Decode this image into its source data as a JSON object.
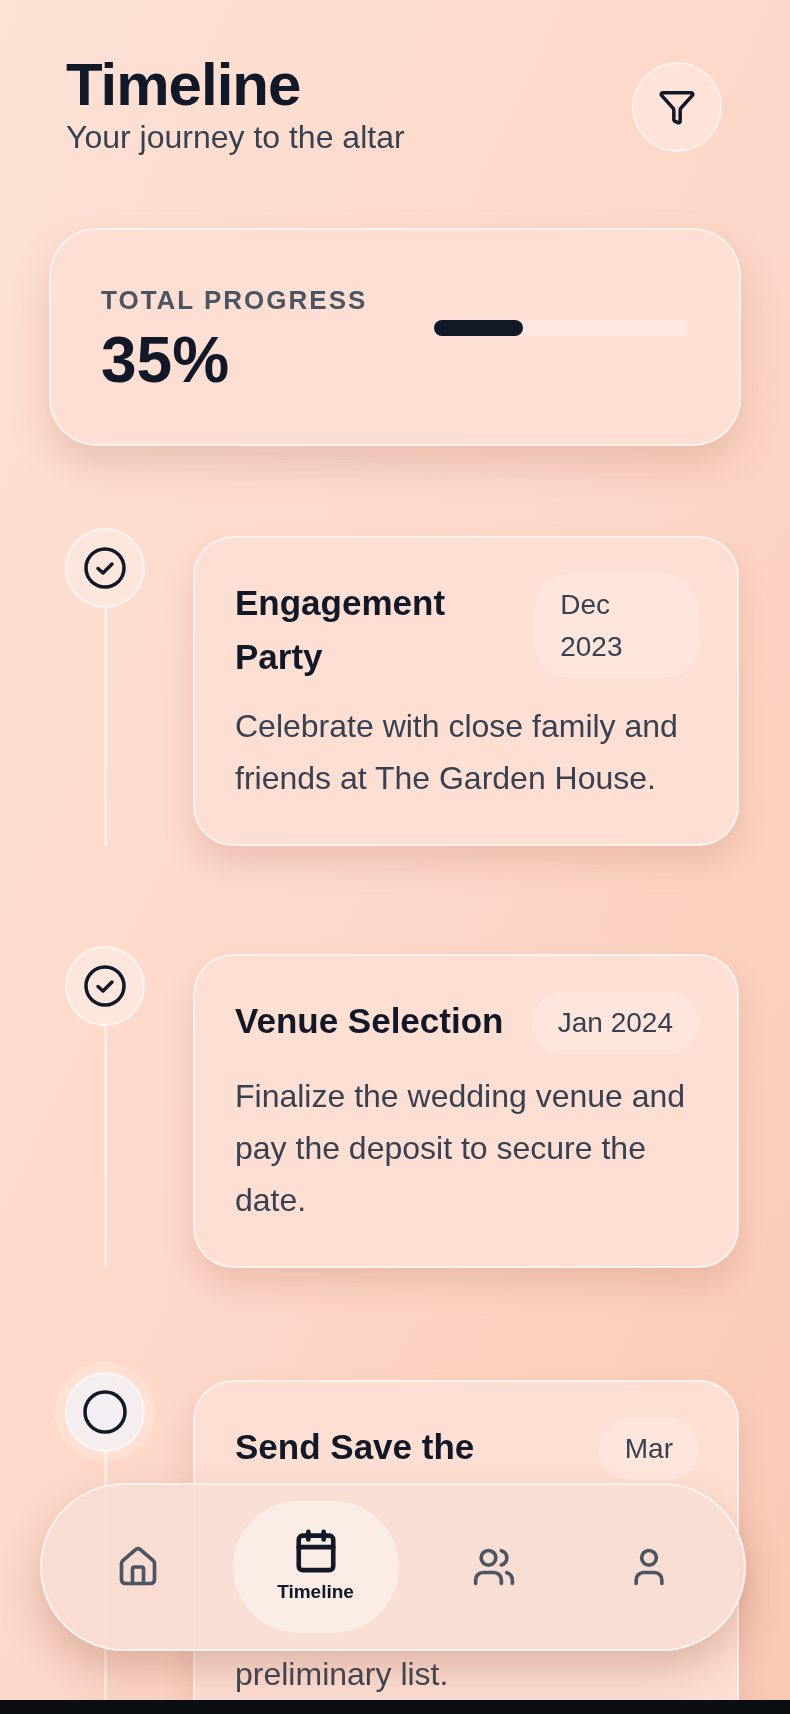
{
  "header": {
    "title": "Timeline",
    "subtitle": "Your journey to the altar"
  },
  "progress": {
    "label": "TOTAL PROGRESS",
    "value": "35%",
    "level": 0.35
  },
  "milestones": [
    {
      "title": "Engagement Party",
      "date": "Dec 2023",
      "description": "Celebrate with close family and friends at The Garden House.",
      "completed": true
    },
    {
      "title": "Venue Selection",
      "date": "Jan 2024",
      "description": "Finalize the wedding venue and pay the deposit to secure the date.",
      "completed": true
    },
    {
      "title": "Send Save the",
      "date": "Mar",
      "description": "preliminary list.",
      "completed": false
    }
  ],
  "nav": [
    {
      "selected": false
    },
    {
      "label": "Timeline",
      "selected": true
    },
    {
      "selected": false
    },
    {
      "selected": false
    }
  ]
}
